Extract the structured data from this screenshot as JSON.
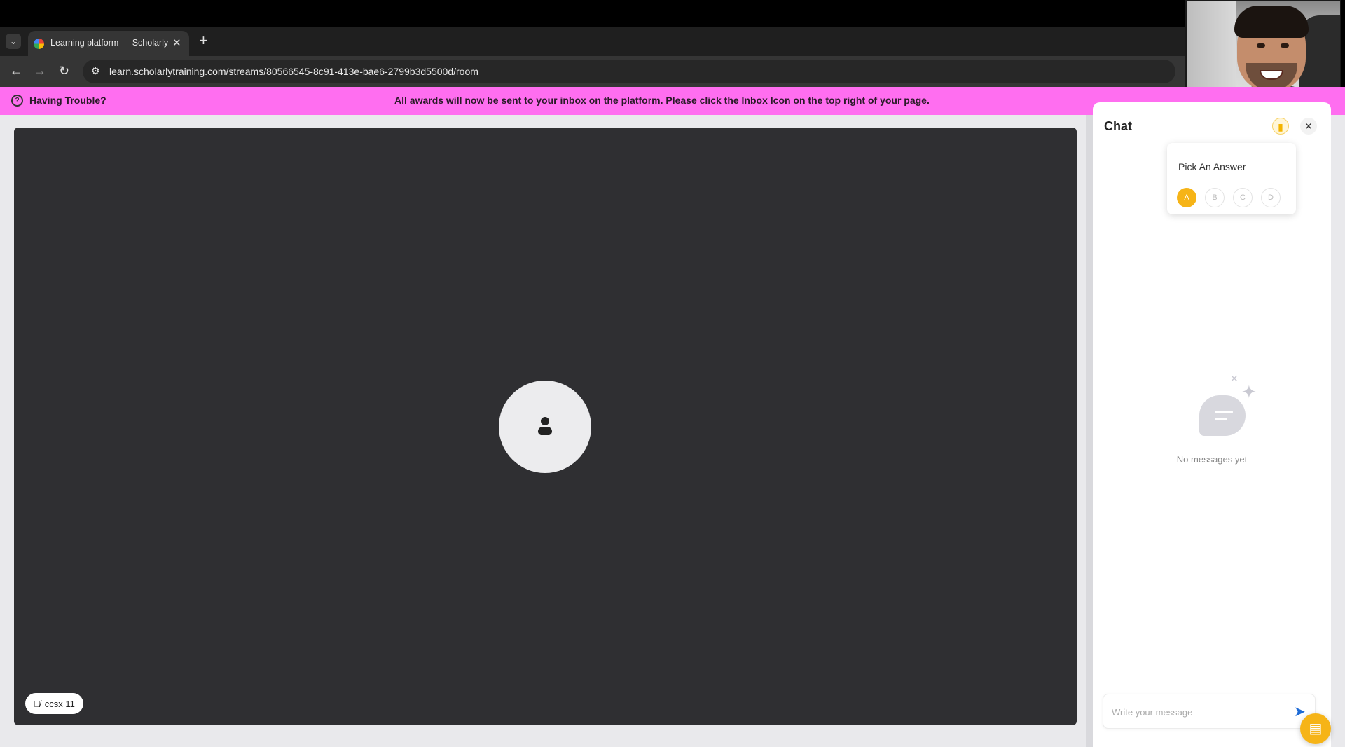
{
  "browser": {
    "tab_menu_icon": "chevron-down-icon",
    "tab_title": "Learning platform — Scholarly",
    "tab_close": "✕",
    "new_tab": "+",
    "url": "learn.scholarlytraining.com/streams/80566545-8c91-413e-bae6-2799b3d5500d/room",
    "nav": {
      "back": "←",
      "forward": "→",
      "reload": "↻"
    }
  },
  "banner": {
    "trouble_label": "Having Trouble?",
    "message": "All awards will now be sent to your inbox on the platform. Please click the Inbox Icon on the top right of your page.",
    "color": "#ff6ef0"
  },
  "stage": {
    "participant_name": "ccsx 11",
    "mic_icon": "mic-off-icon",
    "avatar_icon": "user-icon"
  },
  "chat": {
    "title": "Chat",
    "poll": {
      "title": "Pick An Answer",
      "options": [
        "A",
        "B",
        "C",
        "D"
      ],
      "selected": "A"
    },
    "empty_text": "No messages yet",
    "input_placeholder": "Write your message",
    "send_icon": "send-icon",
    "accent": "#f6b417"
  }
}
